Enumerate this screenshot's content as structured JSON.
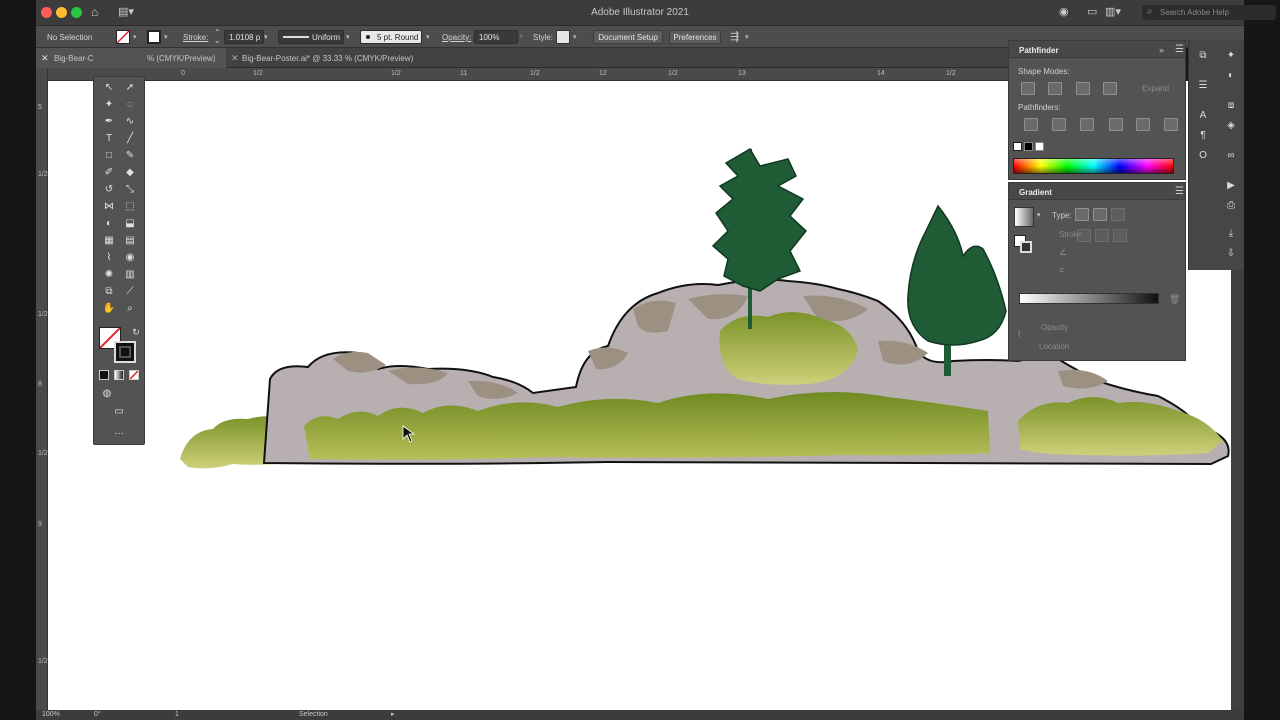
{
  "app": {
    "title": "Adobe Illustrator 2021",
    "search_placeholder": "Search Adobe Help"
  },
  "control_bar": {
    "selection": "No Selection",
    "stroke_label": "Stroke:",
    "stroke_weight": "1.0108 p",
    "profile": "Uniform",
    "brush": "5 pt. Round",
    "opacity_label": "Opacity:",
    "opacity_value": "100%",
    "style_label": "Style:",
    "document_setup": "Document Setup",
    "preferences": "Preferences"
  },
  "tabs": [
    {
      "name": "Big-Bear-C",
      "active": true
    },
    {
      "name": "% (CMYK/Preview)",
      "active": true
    },
    {
      "name": "Big-Bear-Poster.ai* @ 33.33 % (CMYK/Preview)",
      "active": false
    }
  ],
  "ruler": {
    "h_ticks": [
      "0",
      "1/2",
      "1/2",
      "11",
      "1/2",
      "12",
      "1/2",
      "13",
      "14",
      "1/2"
    ],
    "v_ticks": [
      "5",
      "1/2",
      "1/2",
      "8",
      "1/2",
      "9",
      "1/2"
    ]
  },
  "pathfinder": {
    "title": "Pathfinder",
    "shape_modes": "Shape Modes:",
    "pathfinders": "Pathfinders:",
    "expand": "Expand"
  },
  "gradient": {
    "title": "Gradient",
    "type": "Type:",
    "stroke": "Stroke",
    "opacity": "Opacity",
    "location": "Location"
  },
  "status": {
    "zoom": "100%",
    "rotation": "0°",
    "artboard": "1",
    "tool": "Selection"
  },
  "colors": {
    "rock": "#b8afb0",
    "rock_dark": "#9c9082",
    "moss": "#7e8f2a",
    "moss_light": "#b9bf5a",
    "tree": "#1f5b35",
    "canvas": "#ffffff"
  },
  "icons": [
    "selection-tool-icon",
    "direct-selection-icon",
    "magic-wand-icon",
    "lasso-icon",
    "pen-tool-icon",
    "curvature-icon",
    "type-tool-icon",
    "line-tool-icon",
    "rectangle-tool-icon",
    "paintbrush-icon",
    "shaper-icon",
    "eraser-icon",
    "rotate-icon",
    "scale-icon",
    "width-icon",
    "free-transform-icon",
    "shape-builder-icon",
    "live-paint-icon",
    "perspective-icon",
    "mesh-icon",
    "gradient-tool-icon",
    "eyedropper-icon",
    "blend-icon",
    "symbol-sprayer-icon",
    "column-graph-icon",
    "artboard-tool-icon",
    "slice-icon",
    "hand-tool-icon",
    "zoom-tool-icon",
    "fill-swatch-icon",
    "stroke-swatch-icon",
    "draw-mode-icon",
    "screen-mode-icon",
    "more-tools-icon"
  ]
}
